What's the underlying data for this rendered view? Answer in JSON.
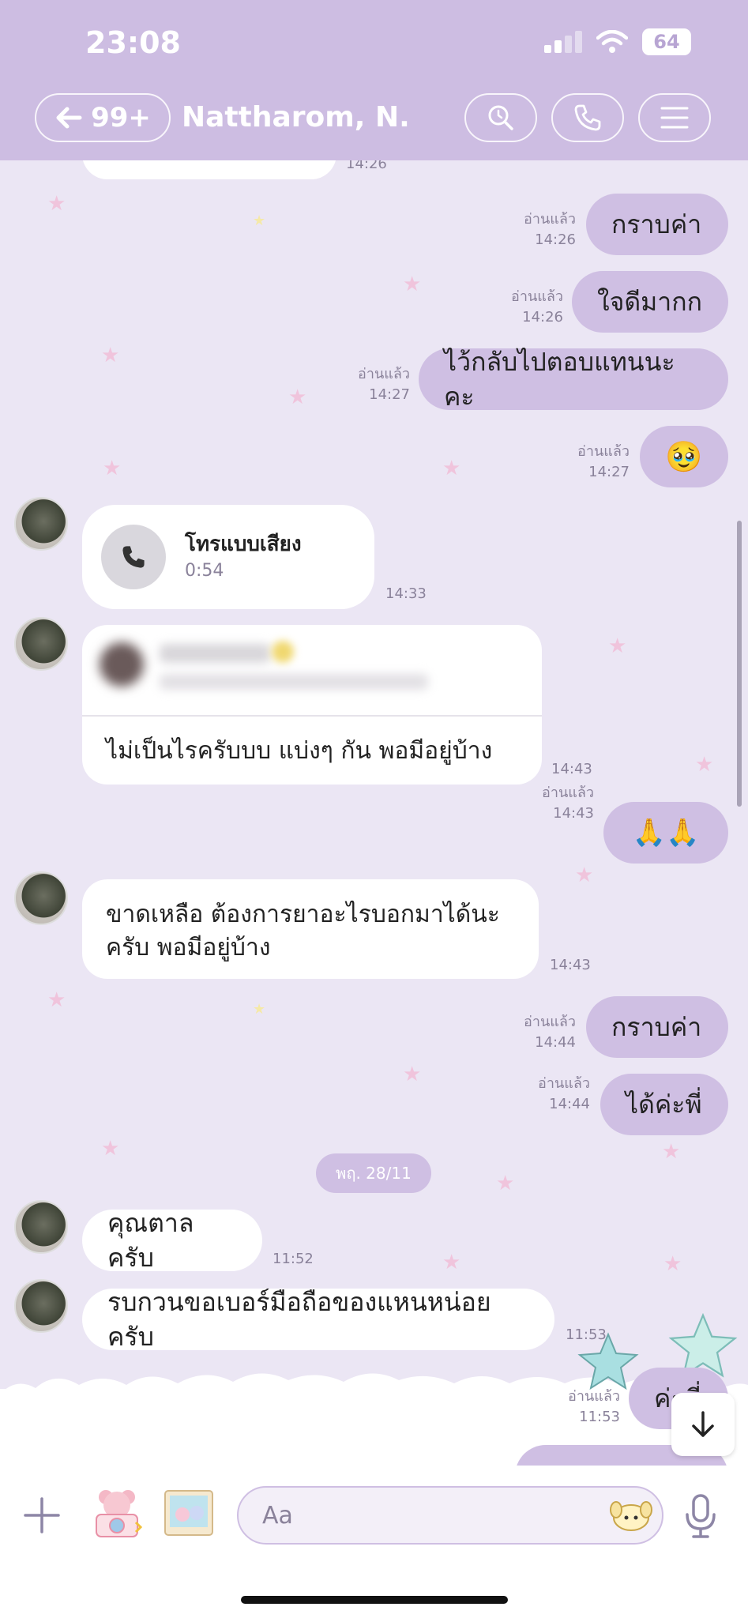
{
  "status_bar": {
    "time": "23:08",
    "battery": "64"
  },
  "header": {
    "back_count": "99+",
    "contact_name": "Nattharom, N."
  },
  "messages": {
    "m0_time": "14:26",
    "m1": {
      "read": "อ่านแล้ว",
      "time": "14:26",
      "text": "กราบค่า"
    },
    "m2": {
      "read": "อ่านแล้ว",
      "time": "14:26",
      "text": "ใจดีมากก"
    },
    "m3": {
      "read": "อ่านแล้ว",
      "time": "14:27",
      "text": "ไว้กลับไปตอบแทนนะคะ"
    },
    "m4": {
      "read": "อ่านแล้ว",
      "time": "14:27",
      "emoji": "🥹"
    },
    "call": {
      "title": "โทรแบบเสียง",
      "duration": "0:54",
      "time": "14:33"
    },
    "m6": {
      "text": "ไม่เป็นไรครับบบ แบ่งๆ กัน พอมีอยู่บ้าง",
      "time": "14:43"
    },
    "m7": {
      "read": "อ่านแล้ว",
      "time": "14:43",
      "emoji": "🙏🙏"
    },
    "m8": {
      "line1": "ขาดเหลือ ต้องการยาอะไรบอกมาได้นะ",
      "line2": "ครับ พอมีอยู่บ้าง",
      "time": "14:43"
    },
    "m9": {
      "read": "อ่านแล้ว",
      "time": "14:44",
      "text": "กราบค่า"
    },
    "m10": {
      "read": "อ่านแล้ว",
      "time": "14:44",
      "text": "ได้ค่ะพี่"
    },
    "date_separator": "พฤ. 28/11",
    "m11": {
      "text": "คุณตาลครับ",
      "time": "11:52"
    },
    "m12": {
      "text": "รบกวนขอเบอร์มือถือของแหนหน่อยครับ",
      "time": "11:53"
    },
    "m13": {
      "read": "อ่านแล้ว",
      "time": "11:53",
      "text": "ค่ะพี่"
    }
  },
  "input": {
    "placeholder": "Aa"
  },
  "colors": {
    "header": "#cdbde2",
    "background": "#ebe6f4",
    "outgoing_bubble": "#cfbfe3",
    "incoming_bubble": "#ffffff"
  },
  "icons": [
    "arrow-left-icon",
    "search-icon",
    "phone-icon",
    "menu-icon",
    "plus-icon",
    "bear-camera-icon",
    "photo-icon",
    "sticker-icon",
    "mic-icon",
    "arrow-down-icon"
  ]
}
